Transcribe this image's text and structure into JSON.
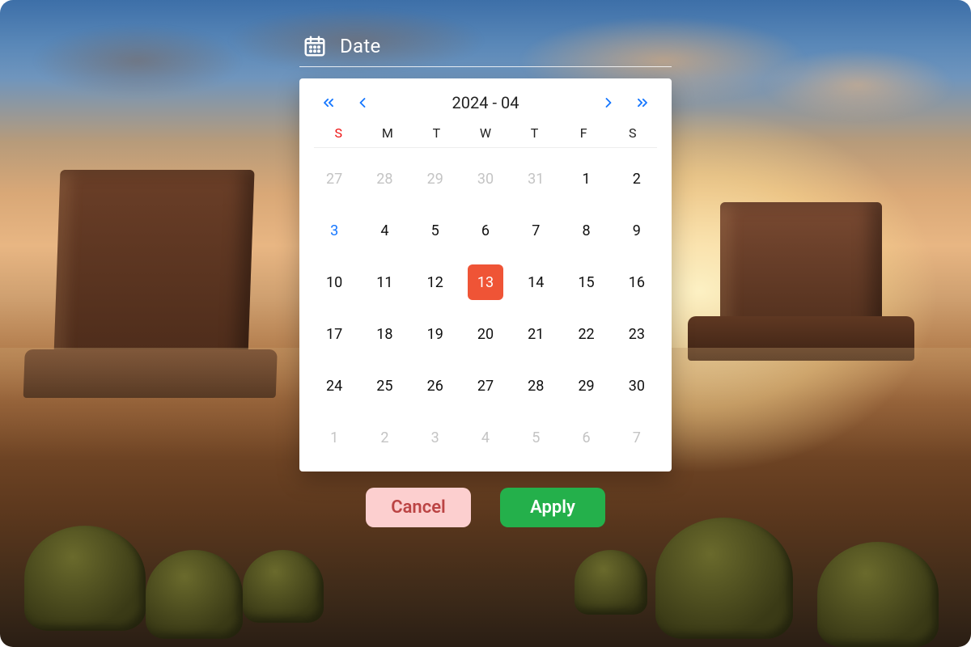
{
  "header": {
    "label": "Date"
  },
  "nav": {
    "title": "2024 - 04"
  },
  "dow": [
    "S",
    "M",
    "T",
    "W",
    "T",
    "F",
    "S"
  ],
  "days": [
    {
      "n": "27",
      "out": true
    },
    {
      "n": "28",
      "out": true
    },
    {
      "n": "29",
      "out": true
    },
    {
      "n": "30",
      "out": true
    },
    {
      "n": "31",
      "out": true
    },
    {
      "n": "1"
    },
    {
      "n": "2"
    },
    {
      "n": "3",
      "today": true
    },
    {
      "n": "4"
    },
    {
      "n": "5"
    },
    {
      "n": "6"
    },
    {
      "n": "7"
    },
    {
      "n": "8"
    },
    {
      "n": "9"
    },
    {
      "n": "10"
    },
    {
      "n": "11"
    },
    {
      "n": "12"
    },
    {
      "n": "13",
      "selected": true
    },
    {
      "n": "14"
    },
    {
      "n": "15"
    },
    {
      "n": "16"
    },
    {
      "n": "17"
    },
    {
      "n": "18"
    },
    {
      "n": "19"
    },
    {
      "n": "20"
    },
    {
      "n": "21"
    },
    {
      "n": "22"
    },
    {
      "n": "23"
    },
    {
      "n": "24"
    },
    {
      "n": "25"
    },
    {
      "n": "26"
    },
    {
      "n": "27"
    },
    {
      "n": "28"
    },
    {
      "n": "29"
    },
    {
      "n": "30"
    },
    {
      "n": "1",
      "out": true
    },
    {
      "n": "2",
      "out": true
    },
    {
      "n": "3",
      "out": true
    },
    {
      "n": "4",
      "out": true
    },
    {
      "n": "5",
      "out": true
    },
    {
      "n": "6",
      "out": true
    },
    {
      "n": "7",
      "out": true
    }
  ],
  "actions": {
    "cancel": "Cancel",
    "apply": "Apply"
  },
  "colors": {
    "accent_blue": "#1677ff",
    "selected": "#ef5436",
    "sunday": "#ee1111",
    "apply": "#24b04b",
    "cancel_bg": "#fccfcf"
  }
}
